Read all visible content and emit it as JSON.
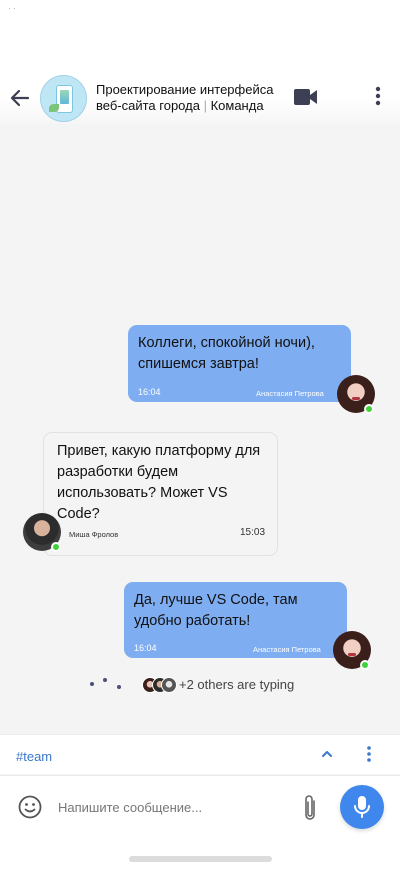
{
  "header": {
    "title_line1": "Проектирование интерфейса",
    "title_line2_main": "веб-сайта города",
    "title_separator": "|",
    "title_line2_suffix": "Команда",
    "icons": {
      "back": "arrow-left-icon",
      "video": "video-camera-icon",
      "more": "more-vertical-icon"
    }
  },
  "messages": [
    {
      "direction": "outgoing",
      "text_line1": "Коллеги, спокойной ночи),",
      "text_line2": "спишемся завтра!",
      "time": "16:04",
      "author": "Анастасия Петрова",
      "online": true
    },
    {
      "direction": "incoming",
      "text_line1": "Привет, какую платформу для",
      "text_line2": "разработки будем",
      "text_line3": "использовать? Может VS",
      "text_line4": "Code?",
      "time": "15:03",
      "author": "Миша Фролов",
      "online": true
    },
    {
      "direction": "outgoing",
      "text_line1": "Да, лучше VS Code, там",
      "text_line2": "удобно  работать!",
      "time": "16:04",
      "author": "Анастасия Петрова",
      "online": true
    }
  ],
  "typing": {
    "text": "+2 others are typing"
  },
  "tagbar": {
    "tag": "#team",
    "icons": {
      "up": "chevron-up-icon",
      "more": "more-vertical-icon"
    }
  },
  "composer": {
    "placeholder": "Напишите сообщение...",
    "icons": {
      "emoji": "smiley-icon",
      "attach": "paperclip-icon",
      "mic": "microphone-icon"
    }
  },
  "colors": {
    "outgoing_bubble": "#7eadf1",
    "incoming_bubble": "#f4f4f5",
    "accent": "#3f87ec",
    "online": "#3ed33a",
    "tag": "#3a78c9"
  }
}
